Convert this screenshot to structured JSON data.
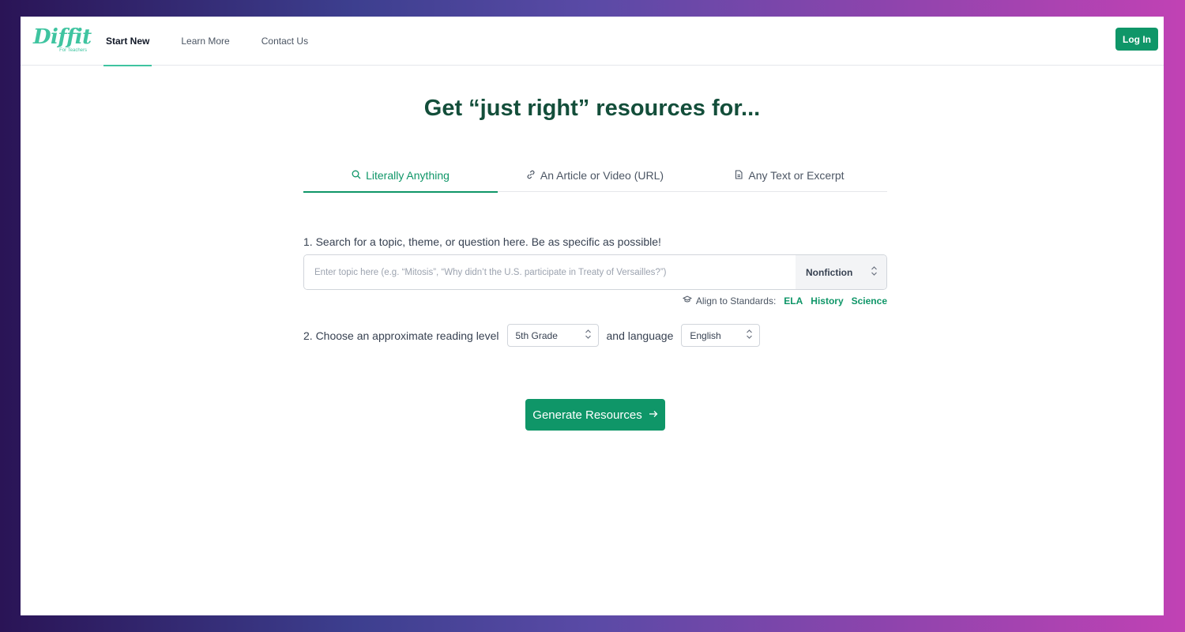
{
  "header": {
    "logo_text": "Diffit",
    "logo_subtext": "For Teachers",
    "nav": [
      {
        "label": "Start New"
      },
      {
        "label": "Learn More"
      },
      {
        "label": "Contact Us"
      }
    ],
    "login_label": "Log In"
  },
  "main": {
    "title": "Get “just right” resources for...",
    "tabs": [
      {
        "label": "Literally Anything",
        "icon": "search-icon"
      },
      {
        "label": "An Article or Video (URL)",
        "icon": "link-icon"
      },
      {
        "label": "Any Text or Excerpt",
        "icon": "document-icon"
      }
    ],
    "step1_label": "1. Search for a topic, theme, or question here. Be as specific as possible!",
    "search_placeholder": "Enter topic here (e.g. “Mitosis”, “Why didn’t the U.S. participate in Treaty of Versailles?”)",
    "genre": "Nonfiction",
    "standards": {
      "label": "Align to Standards:",
      "links": [
        "ELA",
        "History",
        "Science"
      ]
    },
    "step2_label": "2. Choose an approximate reading level",
    "grade": "5th Grade",
    "and_language": "and language",
    "language": "English",
    "generate_label": "Generate Resources"
  },
  "colors": {
    "brand_green": "#0f9668",
    "title_green": "#134e3a",
    "logo_green": "#3fc4a0"
  }
}
